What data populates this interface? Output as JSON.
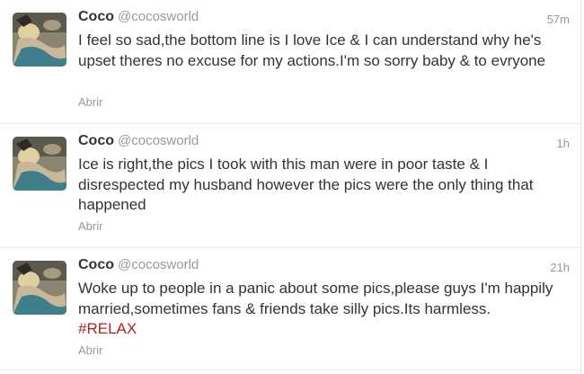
{
  "tweets": [
    {
      "fullname": "Coco",
      "username": "@cocosworld",
      "time": "57m",
      "text": "I feel so sad,the bottom line is I love Ice & I can understand why he's upset theres no excuse for my actions.I'm so sorry baby & to evryone",
      "hashtag": "",
      "expand": "Abrir"
    },
    {
      "fullname": "Coco",
      "username": "@cocosworld",
      "time": "1h",
      "text": "Ice is right,the pics I took with this man were in poor taste & I disrespected my husband however the pics were the only thing that happened",
      "hashtag": "",
      "expand": "Abrir"
    },
    {
      "fullname": "Coco",
      "username": "@cocosworld",
      "time": "21h",
      "text": "Woke up to people in a panic about some pics,please guys I'm happily married,sometimes fans & friends take silly pics.Its harmless.",
      "hashtag": "#RELAX",
      "expand": "Abrir"
    }
  ],
  "colors": {
    "text": "#333333",
    "muted": "#999999",
    "hashtag": "#b22222",
    "divider": "#e8e8e8"
  }
}
